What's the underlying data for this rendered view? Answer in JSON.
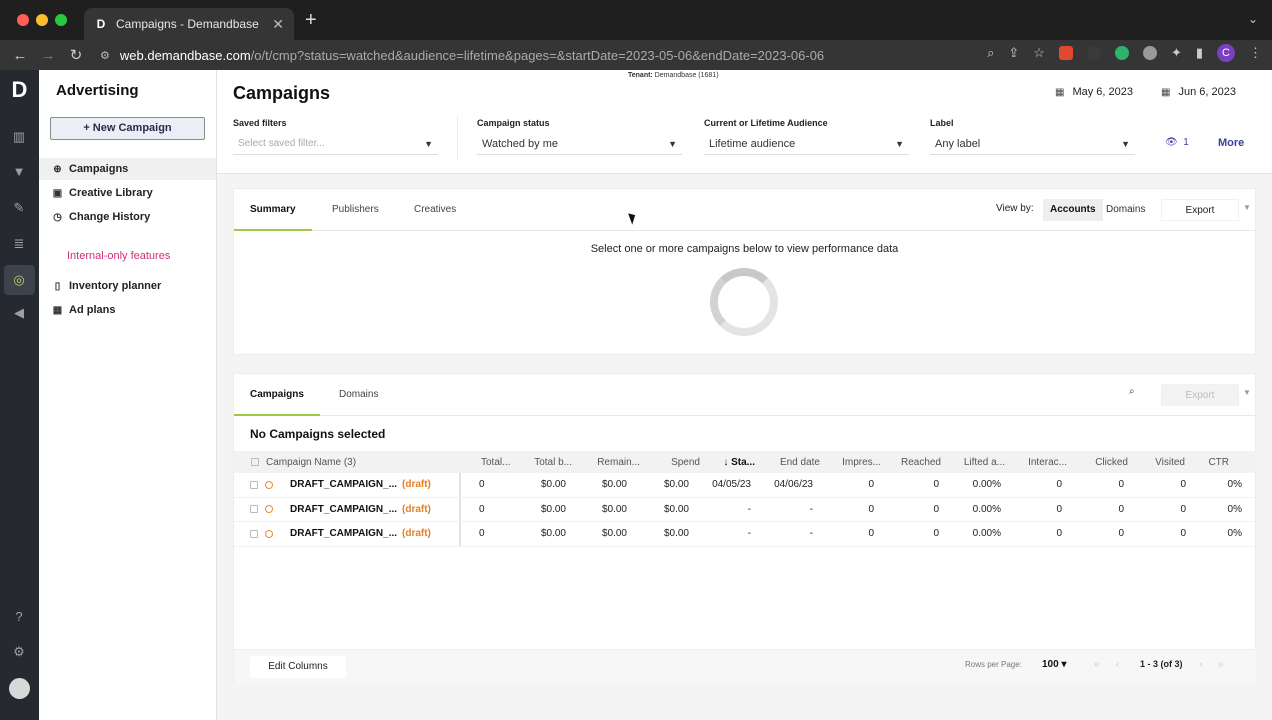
{
  "browser": {
    "tab_title": "Campaigns - Demandbase",
    "tab_favicon": "D",
    "url_host": "web.demandbase.com",
    "url_path": "/o/t/cmp?status=watched&audience=lifetime&pages=&startDate=2023-05-06&endDate=2023-06-06",
    "profile_initial": "C"
  },
  "app": {
    "logo": "D",
    "section_title": "Advertising",
    "new_campaign_label": "+ New Campaign",
    "nav": [
      {
        "label": "Campaigns",
        "icon": "globe-icon"
      },
      {
        "label": "Creative Library",
        "icon": "image-icon"
      },
      {
        "label": "Change History",
        "icon": "history-icon"
      }
    ],
    "internal_label": "Internal-only features",
    "internal_nav": [
      {
        "label": "Inventory planner",
        "icon": "phone-icon"
      },
      {
        "label": "Ad plans",
        "icon": "table-icon"
      }
    ]
  },
  "header": {
    "tenant_prefix": "Tenant:",
    "tenant_value": "Demandbase (1681)",
    "title": "Campaigns",
    "start_date": "May 6, 2023",
    "end_date": "Jun 6, 2023",
    "filters": [
      {
        "label": "Saved filters",
        "value": "Select saved filter..."
      },
      {
        "label": "Campaign status",
        "value": "Watched by me"
      },
      {
        "label": "Current or Lifetime Audience",
        "value": "Lifetime audience"
      },
      {
        "label": "Label",
        "value": "Any label"
      }
    ],
    "watch_count": "1",
    "more_label": "More"
  },
  "summary_panel": {
    "tabs": [
      "Summary",
      "Publishers",
      "Creatives"
    ],
    "view_by_label": "View by:",
    "view_by_options": [
      "Accounts",
      "Domains"
    ],
    "export_label": "Export",
    "message": "Select one or more campaigns below to view performance data"
  },
  "campaigns_panel": {
    "tabs": [
      "Campaigns",
      "Domains"
    ],
    "export_label": "Export",
    "no_selection": "No Campaigns selected",
    "columns": [
      "Campaign Name (3)",
      "Total...",
      "Total b...",
      "Remain...",
      "Spend",
      "Sta...",
      "End date",
      "Impres...",
      "Reached",
      "Lifted a...",
      "Interac...",
      "Clicked",
      "Visited",
      "CTR"
    ],
    "sort_indicator": "↓",
    "rows": [
      {
        "name": "DRAFT_CAMPAIGN_...",
        "status": "(draft)",
        "cells": [
          "0",
          "$0.00",
          "$0.00",
          "$0.00",
          "04/05/23",
          "04/06/23",
          "0",
          "0",
          "0.00%",
          "0",
          "0",
          "0",
          "0%"
        ]
      },
      {
        "name": "DRAFT_CAMPAIGN_...",
        "status": "(draft)",
        "cells": [
          "0",
          "$0.00",
          "$0.00",
          "$0.00",
          "-",
          "-",
          "0",
          "0",
          "0.00%",
          "0",
          "0",
          "0",
          "0%"
        ]
      },
      {
        "name": "DRAFT_CAMPAIGN_...",
        "status": "(draft)",
        "cells": [
          "0",
          "$0.00",
          "$0.00",
          "$0.00",
          "-",
          "-",
          "0",
          "0",
          "0.00%",
          "0",
          "0",
          "0",
          "0%"
        ]
      }
    ],
    "edit_columns_label": "Edit Columns",
    "rows_per_page_label": "Rows per Page:",
    "rows_per_page_value": "100",
    "page_count": "1 - 3 (of 3)"
  },
  "colors": {
    "accent_underline": "#9fc94a",
    "draft_orange": "#e67e22",
    "internal_pink": "#d0307c",
    "link_indigo": "#3b3f9e"
  }
}
